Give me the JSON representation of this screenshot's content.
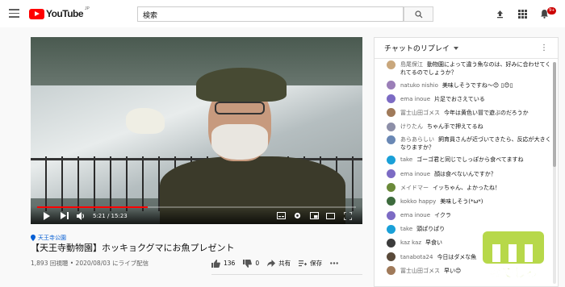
{
  "header": {
    "logo_text": "YouTube",
    "logo_region": "JP",
    "search_placeholder": "検索",
    "notification_count": "9+"
  },
  "player": {
    "current_time": "5:21",
    "duration": "15:23",
    "progress_fraction": 0.348
  },
  "video": {
    "channel_tag": "天王寺公園",
    "title": "【天王寺動物園】ホッキョクグマにお魚プレゼント",
    "meta": "1,893 回視聴 • 2020/08/03 にライブ配信",
    "likes": "136",
    "dislikes": "0",
    "share_label": "共有",
    "save_label": "保存"
  },
  "chat": {
    "header_title": "チャットのリプレイ",
    "messages": [
      {
        "author": "島尾保江",
        "text": "動物園によって違う魚なのは、好みに合わせてくれてるのでしょうか？",
        "color": "#c9a77c"
      },
      {
        "author": "natuko nishio",
        "text": "美味しそうですね〜😊 ▯😊▯",
        "color": "#9b7fb8"
      },
      {
        "author": "ema inoue",
        "text": "片足でおさえている",
        "color": "#7c6bc4"
      },
      {
        "author": "冨士山田ゴメス",
        "text": "今年は黄色い冒で遊ぶのだろうか",
        "color": "#a07a5a"
      },
      {
        "author": "けりたん",
        "text": "ちゃん手で押えてるね",
        "color": "#8d8fa8"
      },
      {
        "author": "あらあらしい",
        "text": "飼育員さんが近づいてきたら、反応が大きくなりますか？",
        "color": "#6a88b5"
      },
      {
        "author": "take",
        "text": "ゴーゴ君と同じでしっぽから食べてますね",
        "color": "#1aa0d8"
      },
      {
        "author": "ema inoue",
        "text": "顔は食べないんですか？",
        "color": "#7c6bc4"
      },
      {
        "author": "メイドマー",
        "text": "イッちゃん、よかったね！",
        "color": "#6b8a3a"
      },
      {
        "author": "kokko happy",
        "text": "美味しそう(*ω*)",
        "color": "#3d6b3d"
      },
      {
        "author": "ema inoue",
        "text": "イクラ",
        "color": "#7c6bc4"
      },
      {
        "author": "take",
        "text": "頭ぱりぱり",
        "color": "#1aa0d8"
      },
      {
        "author": "kaz kaz",
        "text": "早食い",
        "color": "#3c3c3c"
      },
      {
        "author": "tanabota24",
        "text": "今日はダメな魚",
        "color": "#5a4a3a"
      },
      {
        "author": "冨士山田ゴメス",
        "text": "早い😊",
        "color": "#a07a5a"
      }
    ]
  },
  "watermark": {
    "text": "なでしろ"
  }
}
